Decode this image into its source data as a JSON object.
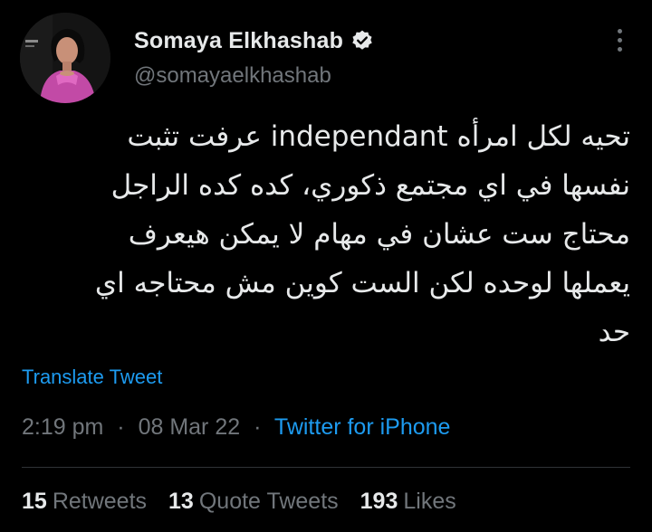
{
  "user": {
    "display_name": "Somaya Elkhashab",
    "handle": "@somayaelkhashab",
    "verified": true,
    "avatar_icon": "profile-photo"
  },
  "tweet": {
    "lines": [
      "تحيه لكل امرأه independant عرفت تثبت",
      "نفسها في اي مجتمع ذكوري، كده كده الراجل",
      "محتاج ست عشان في مهام لا يمكن هيعرف",
      "يعملها لوحده لكن الست كوين مش محتاجه اي",
      "حد"
    ],
    "translate_label": "Translate Tweet",
    "time": "2:19 pm",
    "separator": "·",
    "date": "08 Mar 22",
    "source": "Twitter for iPhone"
  },
  "stats": {
    "retweets_count": "15",
    "retweets_label": "Retweets",
    "quotes_count": "13",
    "quotes_label": "Quote Tweets",
    "likes_count": "193",
    "likes_label": "Likes"
  },
  "colors": {
    "background": "#000000",
    "text": "#e7e9ea",
    "muted": "#71767b",
    "accent": "#1d9bf0",
    "divider": "#2f3336"
  },
  "icons": {
    "verified": "verified-badge-icon",
    "more": "more-options-icon"
  }
}
